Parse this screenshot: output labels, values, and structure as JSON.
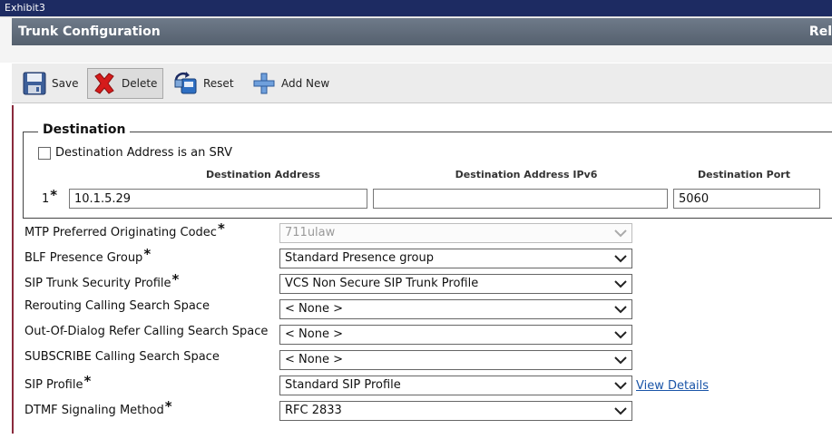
{
  "window": {
    "title": "Exhibit3"
  },
  "header": {
    "title": "Trunk Configuration",
    "right_text": "Rel"
  },
  "toolbar": {
    "save_label": "Save",
    "delete_label": "Delete",
    "reset_label": "Reset",
    "add_new_label": "Add New"
  },
  "destination": {
    "legend": "Destination",
    "srv_label": "Destination Address is an SRV",
    "srv_checked": false,
    "col_address": "Destination Address",
    "col_ipv6": "Destination Address IPv6",
    "col_port": "Destination Port",
    "row_number": "1",
    "required_mark": "*",
    "address_value": "10.1.5.29",
    "ipv6_value": "",
    "port_value": "5060"
  },
  "fields": {
    "mtp_label": "MTP Preferred Originating Codec",
    "mtp_value": "711ulaw",
    "blf_label": "BLF Presence Group",
    "blf_value": "Standard Presence group",
    "security_label": "SIP Trunk Security Profile",
    "security_value": "VCS Non Secure SIP Trunk Profile",
    "rerouting_label": "Rerouting Calling Search Space",
    "rerouting_value": "< None >",
    "ood_label": "Out-Of-Dialog Refer Calling Search Space",
    "ood_value": "< None >",
    "subscribe_label": "SUBSCRIBE Calling Search Space",
    "subscribe_value": "< None >",
    "sip_profile_label": "SIP Profile",
    "sip_profile_value": "Standard SIP Profile",
    "view_details": "View Details",
    "dtmf_label": "DTMF Signaling Method",
    "dtmf_value": "RFC 2833",
    "required_mark": "*"
  },
  "icons": {
    "save": "floppy-disk-icon",
    "delete": "red-x-icon",
    "reset": "reset-icon",
    "add": "blue-plus-icon",
    "dropdown": "chevron-down-icon"
  }
}
